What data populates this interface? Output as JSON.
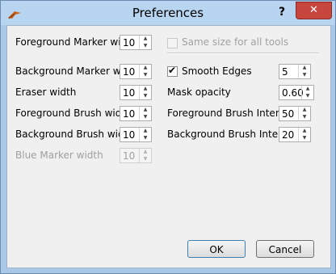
{
  "window": {
    "title": "Preferences",
    "help_label": "?",
    "close_label": "✕"
  },
  "left_fields": [
    {
      "label": "Foreground Marker width",
      "value": "10",
      "enabled": true
    },
    {
      "label": "Background Marker width",
      "value": "10",
      "enabled": true
    },
    {
      "label": "Eraser width",
      "value": "10",
      "enabled": true
    },
    {
      "label": "Foreground Brush width",
      "value": "10",
      "enabled": true
    },
    {
      "label": "Background Brush width",
      "value": "10",
      "enabled": true
    },
    {
      "label": "Blue Marker width",
      "value": "10",
      "enabled": false
    }
  ],
  "same_size": {
    "label": "Same size for all tools",
    "checked": false,
    "enabled": false
  },
  "smooth_edges": {
    "label": "Smooth Edges",
    "checked": true,
    "value": "5"
  },
  "mask_opacity": {
    "label": "Mask opacity",
    "value": "0.60"
  },
  "fg_brush_intensity": {
    "label": "Foreground Brush Intensity",
    "value": "50"
  },
  "bg_brush_intensity": {
    "label": "Background Brush Intensity",
    "value": "20"
  },
  "buttons": {
    "ok": "OK",
    "cancel": "Cancel"
  },
  "icons": {
    "app": "app-feather-icon",
    "spin_up": "arrow-up-icon",
    "spin_down": "arrow-down-icon",
    "check": "checkmark-icon"
  }
}
